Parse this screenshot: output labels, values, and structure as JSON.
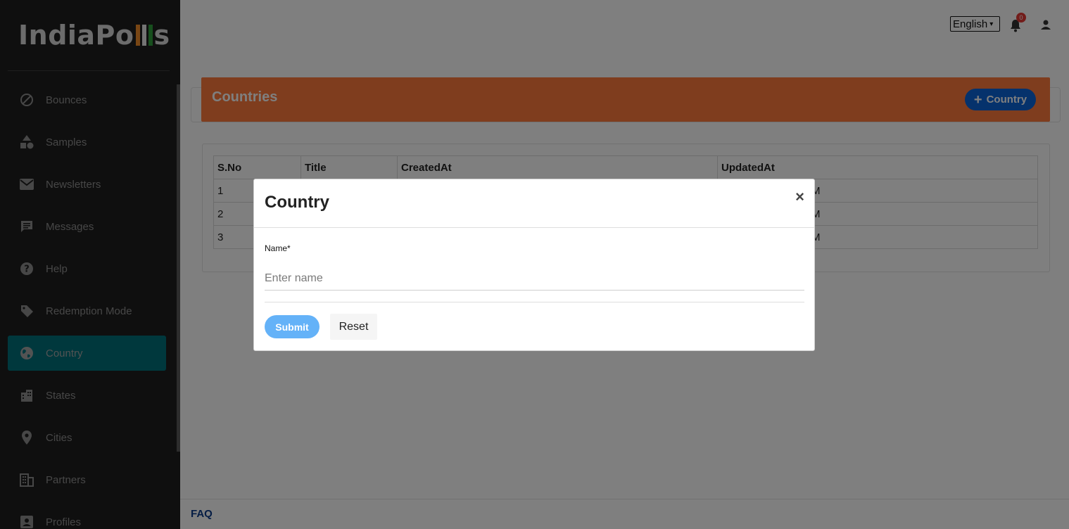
{
  "app": {
    "logo_text_left": "IndiaPo",
    "logo_text_right": "s",
    "logo_bar_colors": [
      "#f28c28",
      "#e8e8e8",
      "#2e9e3a"
    ]
  },
  "sidebar": {
    "items": [
      {
        "label": "Bounces",
        "icon": "block-icon"
      },
      {
        "label": "Samples",
        "icon": "shapes-icon"
      },
      {
        "label": "Newsletters",
        "icon": "mail-icon"
      },
      {
        "label": "Messages",
        "icon": "chat-icon"
      },
      {
        "label": "Help",
        "icon": "help-icon"
      },
      {
        "label": "Redemption Mode",
        "icon": "tag-icon"
      },
      {
        "label": "Country",
        "icon": "globe-icon",
        "active": true
      },
      {
        "label": "States",
        "icon": "city-icon"
      },
      {
        "label": "Cities",
        "icon": "location-pin-icon"
      },
      {
        "label": "Partners",
        "icon": "building-icon"
      },
      {
        "label": "Profiles",
        "icon": "contact-icon"
      }
    ],
    "active_color": "#01707a"
  },
  "topbar": {
    "language": "English",
    "notification_count": "0"
  },
  "page": {
    "title": "Countries",
    "add_button_label": "Country",
    "header_color": "#ff7a3c"
  },
  "table": {
    "columns": [
      "S.No",
      "Title",
      "CreatedAt",
      "UpdatedAt"
    ],
    "rows": [
      {
        "sno": "1",
        "updated_tail": "M"
      },
      {
        "sno": "2",
        "updated_tail": "M"
      },
      {
        "sno": "3",
        "updated_tail": "M"
      }
    ]
  },
  "footer": {
    "faq_label": "FAQ"
  },
  "modal": {
    "title": "Country",
    "close_label": "×",
    "field_label": "Name*",
    "field_placeholder": "Enter name",
    "field_value": "",
    "submit_label": "Submit",
    "reset_label": "Reset"
  }
}
